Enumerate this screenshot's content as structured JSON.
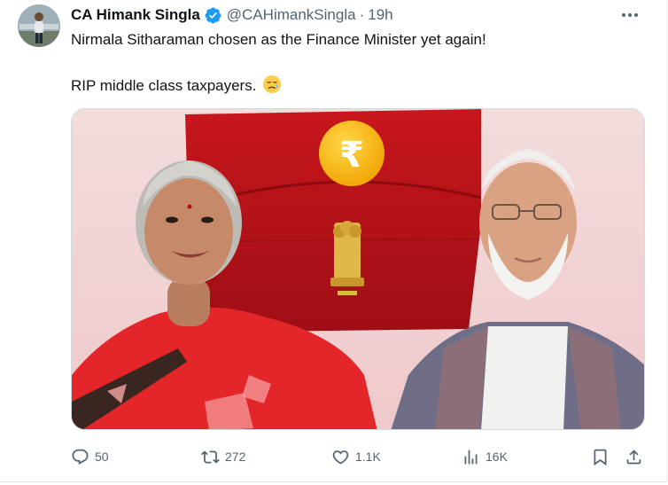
{
  "tweet": {
    "author_name": "CA Himank Singla",
    "handle": "@CAHimankSingla",
    "separator": "·",
    "time": "19h",
    "text_line1": "Nirmala Sitharaman chosen as the Finance Minister yet again!",
    "text_line2": "RIP middle class taxpayers.",
    "emoji": "😥"
  },
  "media": {
    "rupee_symbol": "₹"
  },
  "actions": {
    "replies": "50",
    "retweets": "272",
    "likes": "1.1K",
    "views": "16K"
  },
  "colors": {
    "verified_blue": "#1d9bf0",
    "secondary_text": "#536471",
    "primary_text": "#0f1419"
  },
  "icons": [
    "more-icon",
    "verified-icon",
    "reply-icon",
    "retweet-icon",
    "like-icon",
    "views-icon",
    "bookmark-icon",
    "share-icon"
  ]
}
